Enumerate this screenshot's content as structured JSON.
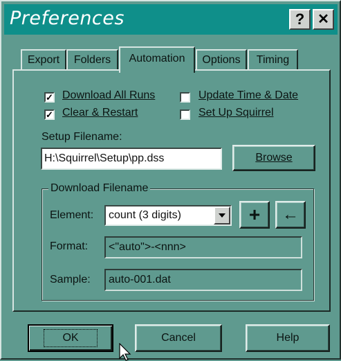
{
  "window": {
    "title": "Preferences"
  },
  "titlebar": {
    "help_label": "?",
    "close_label": "✕"
  },
  "tabs": [
    {
      "label": "Export"
    },
    {
      "label": "Folders"
    },
    {
      "label": "Automation",
      "active": true
    },
    {
      "label": "Options"
    },
    {
      "label": "Timing"
    }
  ],
  "checkboxes": {
    "download_all_runs": {
      "label": "Download All Runs",
      "checked": true
    },
    "clear_restart": {
      "label": "Clear & Restart",
      "checked": true
    },
    "update_time_date": {
      "label": "Update Time & Date",
      "checked": false
    },
    "set_up_squirrel": {
      "label": "Set Up Squirrel",
      "checked": false
    }
  },
  "setup": {
    "label": "Setup Filename:",
    "value": "H:\\Squirrel\\Setup\\pp.dss",
    "browse_label": "Browse"
  },
  "download": {
    "group_label": "Download Filename",
    "element_label": "Element:",
    "element_value": "count (3 digits)",
    "format_label": "Format:",
    "format_value": "<\"auto\">-<nnn>",
    "sample_label": "Sample:",
    "sample_value": "auto-001.dat",
    "add_label": "+",
    "back_label": "←"
  },
  "footer": {
    "ok_label": "OK",
    "cancel_label": "Cancel",
    "help_label": "Help"
  },
  "colors": {
    "dialog_bg": "#5f9a8f",
    "titlebar_bg": "#0f8f8a"
  }
}
